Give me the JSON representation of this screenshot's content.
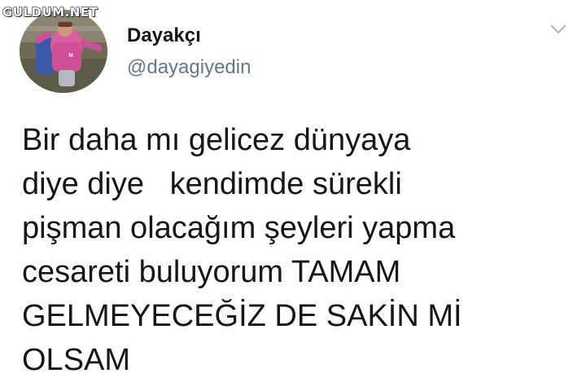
{
  "watermark": {
    "text": "GULDUM.NET"
  },
  "tweet": {
    "display_name": "Dayakçı",
    "handle": "@dayagiyedin",
    "text_lines": [
      "Bir daha mı gelicez dünyaya",
      "diye diye   kendimde sürekli",
      "pişman olacağım şeyleri yapma",
      "cesareti buluyorum TAMAM",
      "GELMEYECEĞİZ DE SAKİN Mİ",
      "OLSAM"
    ]
  },
  "icons": {
    "menu": "chevron-down-icon"
  },
  "colors": {
    "text": "#14171a",
    "handle": "#657786",
    "chevron": "#aab8c2"
  }
}
